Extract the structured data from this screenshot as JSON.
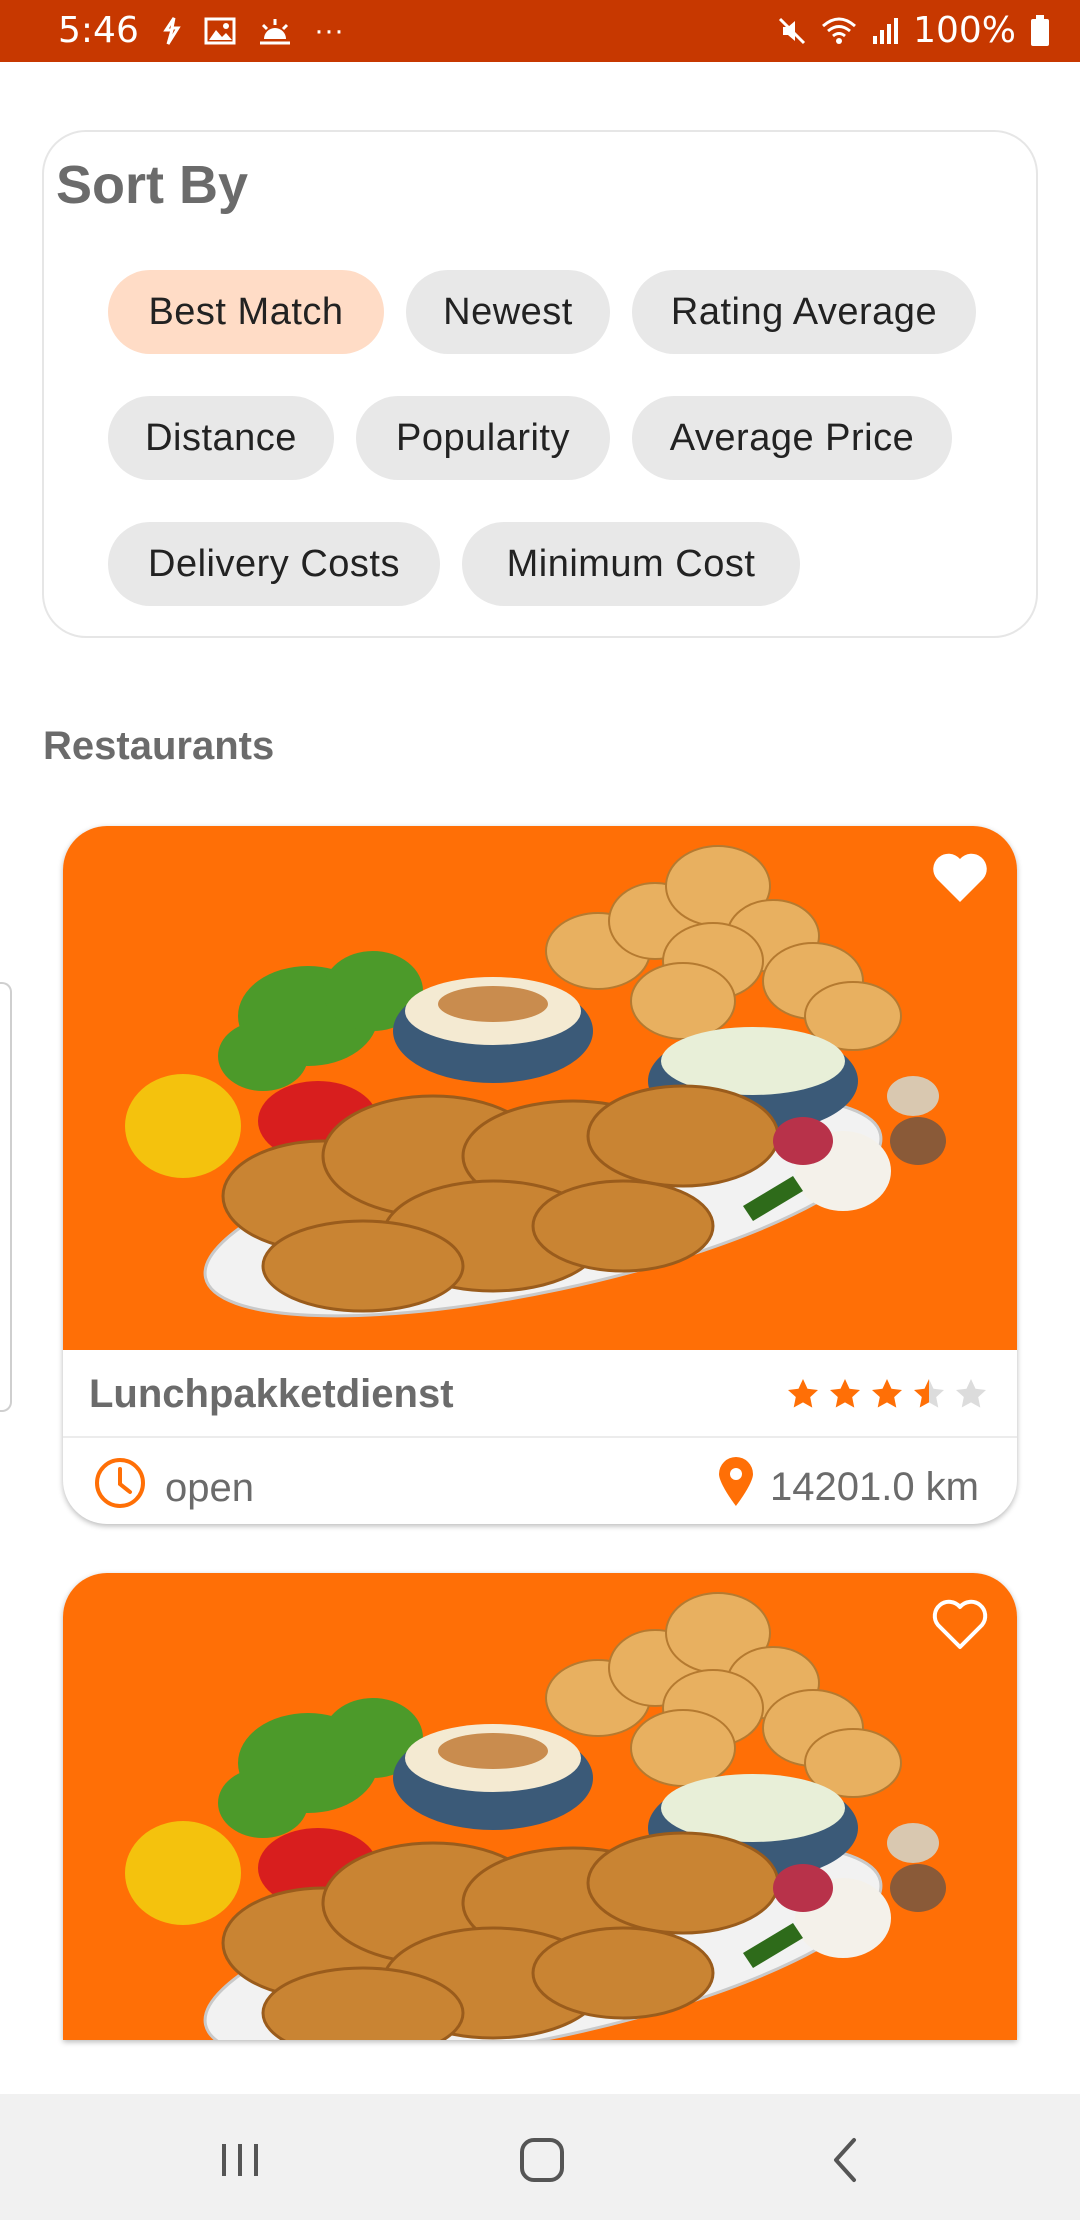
{
  "status_bar": {
    "time": "5:46",
    "more": "···",
    "battery": "100%",
    "background": "#c73800"
  },
  "sort": {
    "title": "Sort By",
    "options": [
      {
        "label": "Best Match",
        "selected": true
      },
      {
        "label": "Newest",
        "selected": false
      },
      {
        "label": "Rating Average",
        "selected": false
      },
      {
        "label": "Distance",
        "selected": false
      },
      {
        "label": "Popularity",
        "selected": false
      },
      {
        "label": "Average Price",
        "selected": false
      },
      {
        "label": "Delivery Costs",
        "selected": false
      },
      {
        "label": "Minimum Cost",
        "selected": false
      }
    ],
    "selected_color": "#ffdcc6",
    "chip_color": "#e8e8e8"
  },
  "restaurants": {
    "title": "Restaurants",
    "accent": "#ff6f06",
    "items": [
      {
        "name": "Lunchpakketdienst",
        "rating": 3.5,
        "rating_max": 5,
        "status": "open",
        "distance": "14201.0 km",
        "favorite": true,
        "image": "fried-chicken-platter"
      },
      {
        "name": "",
        "favorite": false,
        "image": "fried-chicken-platter"
      }
    ]
  },
  "nav_bar": {
    "buttons": [
      "recents-icon",
      "home-icon",
      "back-icon"
    ]
  }
}
